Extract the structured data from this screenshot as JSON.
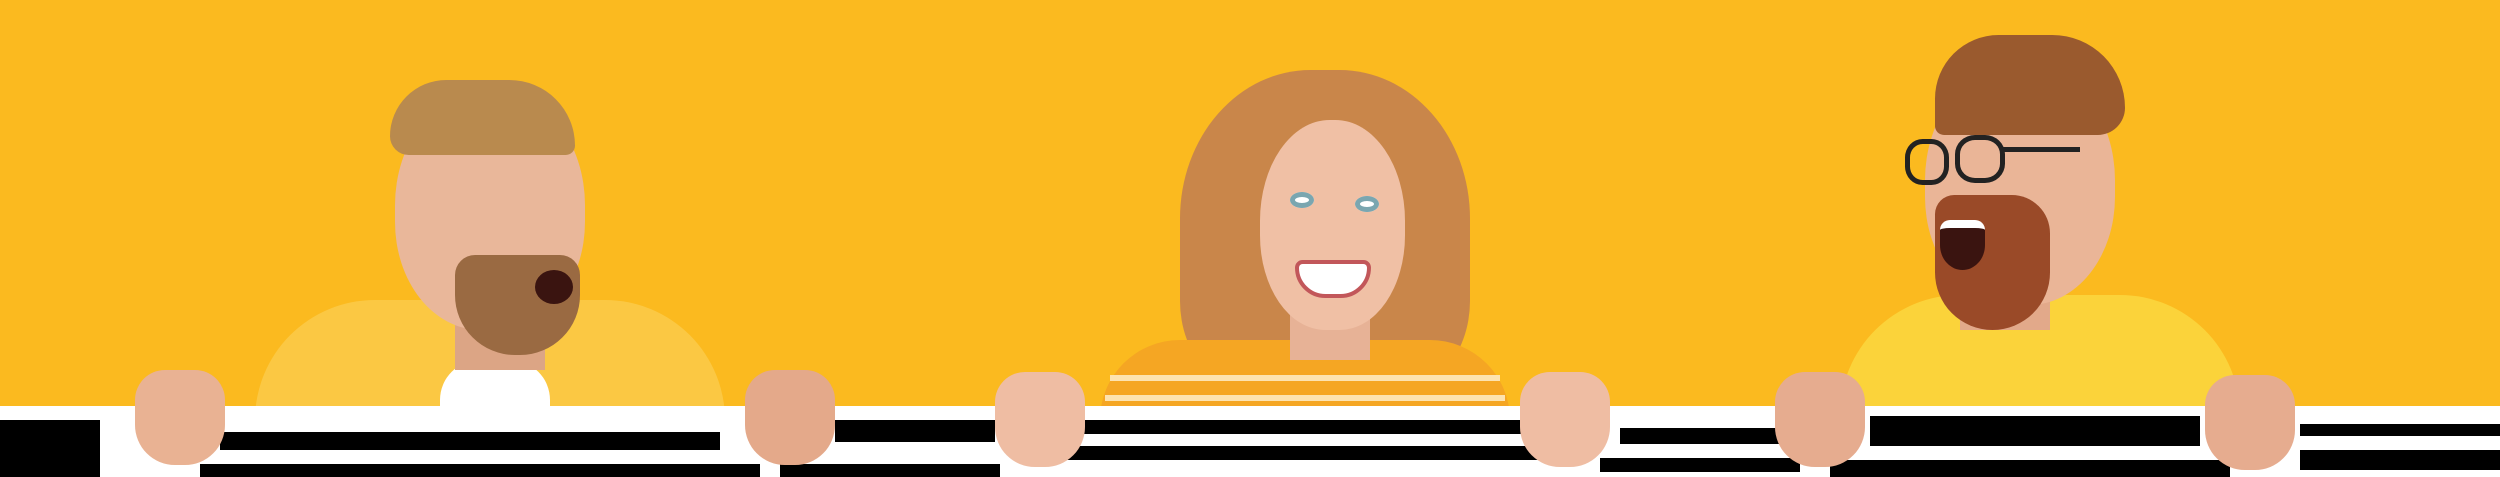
{
  "scene": {
    "description_colors": {
      "background": "#fbba1f",
      "skin": "#e9b79a",
      "hair_blond": "#b98a4e",
      "hair_curly": "#c9864a",
      "hair_ginger": "#9a5a2e",
      "shirt_left": "#fbc843",
      "shirt_middle": "#f5a623",
      "shirt_right": "#fbd33a",
      "board": "#ffffff"
    }
  }
}
